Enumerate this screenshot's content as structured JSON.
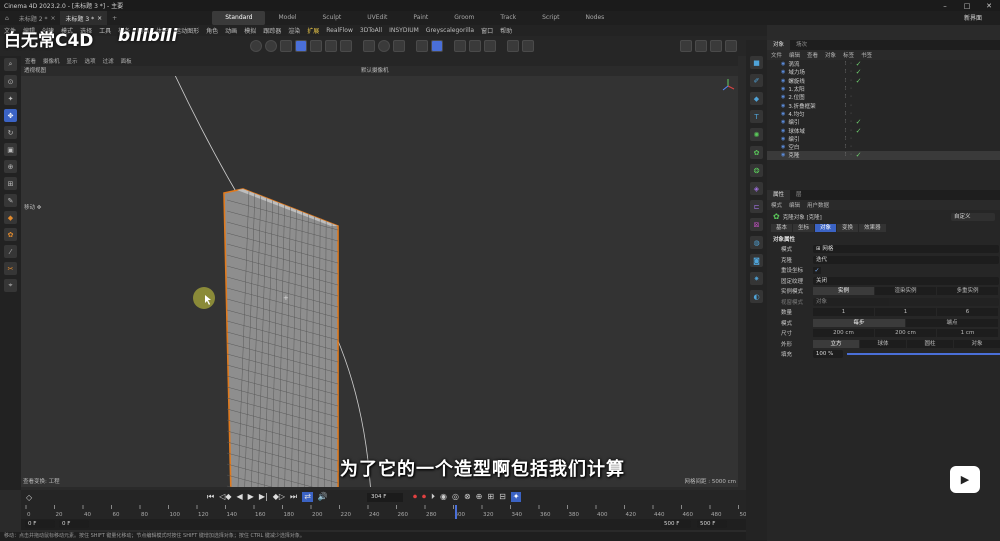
{
  "window": {
    "title": "Cinema 4D 2023.2.0 - [未标题 3 *] - 主要"
  },
  "doc_tabs": [
    {
      "label": "未标题 2 *"
    },
    {
      "label": "未标题 3 *"
    }
  ],
  "layouts": [
    "Standard",
    "Model",
    "Sculpt",
    "UVEdit",
    "Paint",
    "Groom",
    "Track",
    "Script",
    "Nodes"
  ],
  "layout_selected": "Standard",
  "new_ui_label": "新界面",
  "menu": [
    "文件",
    "编辑",
    "创建",
    "模式",
    "选择",
    "工具",
    "样条",
    "网格",
    "体积",
    "运动图形",
    "角色",
    "动画",
    "模拟",
    "跟踪器",
    "渲染",
    "扩展",
    "RealFlow",
    "3DToAll",
    "INSYDIUM",
    "Greyscalegorilla",
    "窗口",
    "帮助"
  ],
  "viewport": {
    "menu": [
      "查看",
      "摄像机",
      "显示",
      "选项",
      "过滤",
      "面板"
    ],
    "view_name": "透视视图",
    "camera": "默认摄像机",
    "move_label": "移动",
    "footer_left": "查看变换: 工程",
    "footer_right": "网格间距 : 5000 cm"
  },
  "timeline": {
    "current_frame": "304 F",
    "start": "0 F",
    "start2": "0 F",
    "end": "500 F",
    "end2": "500 F",
    "ticks": [
      "0",
      "20",
      "40",
      "60",
      "80",
      "100",
      "120",
      "140",
      "160",
      "180",
      "200",
      "220",
      "240",
      "260",
      "280",
      "300",
      "320",
      "340",
      "360",
      "380",
      "400",
      "420",
      "440",
      "460",
      "480",
      "500"
    ]
  },
  "status": "移动：点击并拖动鼠标移动元素。按住 SHIFT 键量化移动；节点编辑模式时按住 SHIFT 键增加选择对象；按住 CTRL 键减少选择对象。",
  "object_panel": {
    "tabs": [
      "对象",
      "场次"
    ],
    "menu": [
      "文件",
      "编辑",
      "查看",
      "对象",
      "标签",
      "书签"
    ],
    "objects": [
      {
        "name": "涡流",
        "check": true
      },
      {
        "name": "域力场",
        "check": true
      },
      {
        "name": "螺旋线",
        "check": true
      },
      {
        "name": "1.太阳",
        "check": false
      },
      {
        "name": "2.位图",
        "check": false
      },
      {
        "name": "3.折叠框架",
        "check": false
      },
      {
        "name": "4.均匀",
        "check": false
      },
      {
        "name": "编引",
        "check": true
      },
      {
        "name": "球体域",
        "check": true
      },
      {
        "name": "编引",
        "check": false
      },
      {
        "name": "空白",
        "check": false
      },
      {
        "name": "克隆",
        "check": true
      }
    ]
  },
  "attr_panel": {
    "tabs": [
      "属性",
      "层"
    ],
    "menu": [
      "模式",
      "编辑",
      "用户数据"
    ],
    "object_title": "克隆对象 [克隆]",
    "preset": "自定义",
    "subtabs": [
      "基本",
      "坐标",
      "对象",
      "变换",
      "效果器"
    ],
    "subtab_selected": "对象",
    "section": "对象属性",
    "mode_label": "模式",
    "mode_value": "网格",
    "clone_label": "克隆",
    "clone_value": "迭代",
    "reset_label": "重设坐标",
    "fixed_label": "固定纹理",
    "fixed_value": "关闭",
    "instance_label": "实例模式",
    "instance_options": [
      "实例",
      "渲染实例",
      "多重实例"
    ],
    "viewport_label": "视窗模式",
    "viewport_value": "对象",
    "count_label": "数量",
    "count_values": [
      "1",
      "1",
      "6"
    ],
    "mode2_label": "模式",
    "mode2_options": [
      "每步",
      "端点"
    ],
    "size_label": "尺寸",
    "size_values": [
      "200 cm",
      "200 cm",
      "1 cm"
    ],
    "shape_label": "外形",
    "shape_options": [
      "立方",
      "球体",
      "圆柱",
      "对象"
    ],
    "fill_label": "填充",
    "fill_value": "100 %"
  },
  "overlay": {
    "watermark": "白无常C4D",
    "bili": "bilibili",
    "subtitle": "为了它的一个造型啊包括我们计算"
  }
}
